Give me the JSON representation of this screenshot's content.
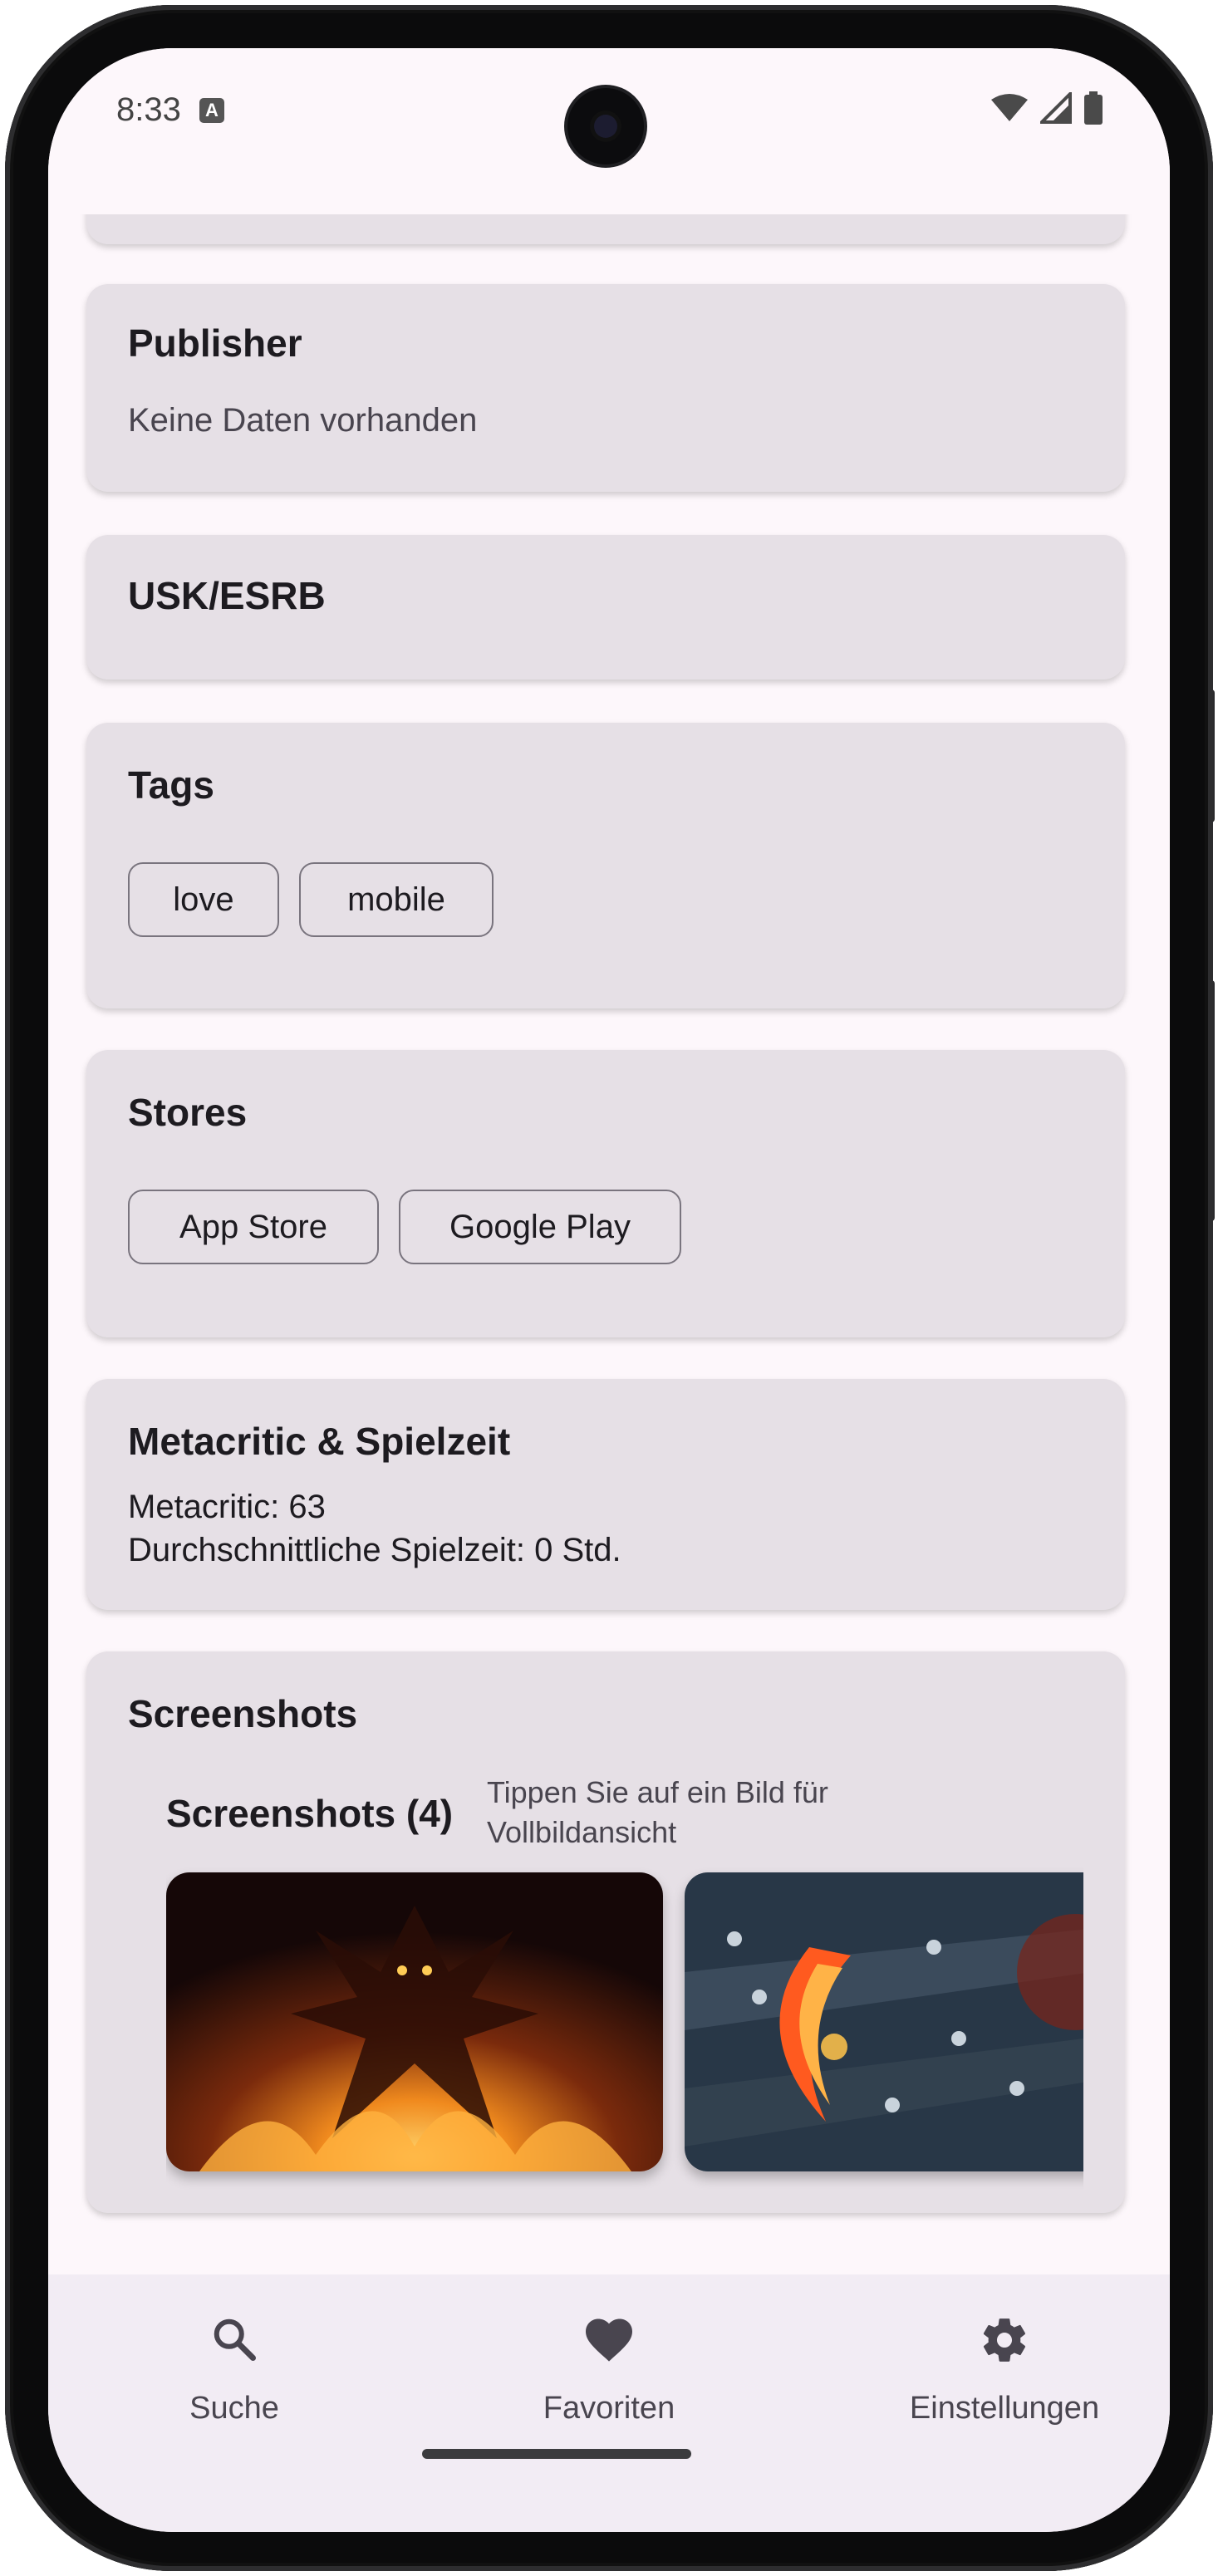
{
  "status_bar": {
    "time": "8:33",
    "badge": "A"
  },
  "cards": {
    "publisher": {
      "title": "Publisher",
      "value": "Keine Daten vorhanden"
    },
    "rating": {
      "title": "USK/ESRB"
    },
    "tags": {
      "title": "Tags",
      "items": [
        "love",
        "mobile"
      ]
    },
    "stores": {
      "title": "Stores",
      "items": [
        "App Store",
        "Google Play"
      ]
    },
    "metacritic": {
      "title": "Metacritic & Spielzeit",
      "score_line": "Metacritic: 63",
      "playtime_line": "Durchschnittliche Spielzeit: 0 Std."
    },
    "screenshots": {
      "title": "Screenshots",
      "gallery_title": "Screenshots (4)",
      "hint_line1": "Tippen Sie auf ein Bild für",
      "hint_line2": "Vollbildansicht"
    }
  },
  "bottom_nav": {
    "items": [
      {
        "label": "Suche",
        "icon": "search-icon"
      },
      {
        "label": "Favoriten",
        "icon": "heart-icon"
      },
      {
        "label": "Einstellungen",
        "icon": "gear-icon"
      }
    ]
  },
  "colors": {
    "background": "#fdf7fb",
    "card": "#e6e0e6",
    "nav_bar": "#f2ecf4",
    "text_primary": "#1d1b20",
    "text_secondary": "#49454f"
  }
}
